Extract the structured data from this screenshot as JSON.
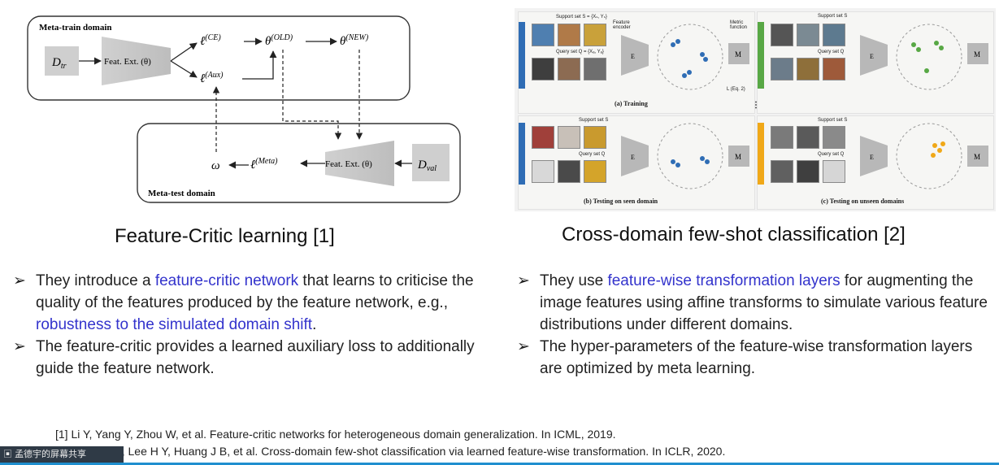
{
  "diagram": {
    "meta_train_label": "Meta-train domain",
    "meta_test_label": "Meta-test domain",
    "d_tr": "D",
    "d_tr_sub": "tr",
    "feat_ext": "Feat. Ext. (θ)",
    "l_ce": "ℓ",
    "l_ce_sup": "(CE)",
    "l_aux": "ℓ",
    "l_aux_sup": "(Aux)",
    "theta_old": "θ",
    "theta_old_sup": "(OLD)",
    "theta_new": "θ",
    "theta_new_sup": "(NEW)",
    "omega": "ω",
    "l_meta": "ℓ",
    "l_meta_sup": "(Meta)",
    "d_val": "D",
    "d_val_sub": "val"
  },
  "cdfs": {
    "support_set_top": "Support set S = {Xₛ, Yₛ}",
    "query_set_top": "Query set Q = {Xₐ, Yₐ}",
    "feature_encoder": "Feature encoder",
    "metric_function": "Metric function",
    "loss_label": "L (Eq. 2)",
    "training_caption": "(a) Training",
    "support_set": "Support set S",
    "query_set": "Query set Q",
    "seen_caption": "(b) Testing on seen domain",
    "unseen_caption": "(c) Testing on unseen domains",
    "f_label": "E",
    "m_label": "M"
  },
  "left": {
    "title": "Feature-Critic learning [1]",
    "bullets": [
      [
        {
          "t": "They introduce a ",
          "hl": false
        },
        {
          "t": "feature-critic network",
          "hl": true
        },
        {
          "t": " that learns to criticise the quality of the features produced by the feature network, e.g., ",
          "hl": false
        },
        {
          "t": "robustness to the simulated domain shift",
          "hl": true
        },
        {
          "t": ".",
          "hl": false
        }
      ],
      [
        {
          "t": " The feature-critic provides a learned auxiliary loss to additionally guide the feature network.",
          "hl": false
        }
      ]
    ]
  },
  "right": {
    "title": "Cross-domain few-shot classification [2]",
    "bullets": [
      [
        {
          "t": "They use ",
          "hl": false
        },
        {
          "t": "feature-wise transformation layers",
          "hl": true
        },
        {
          "t": " for augmenting the image features using affine transforms to simulate various feature distributions under different domains.",
          "hl": false
        }
      ],
      [
        {
          "t": " The hyper-parameters of the feature-wise transformation layers are optimized by meta learning.",
          "hl": false
        }
      ]
    ]
  },
  "references": [
    "[1] Li Y, Yang Y, Zhou W, et al. Feature-critic networks for heterogeneous domain generalization. In ICML, 2019.",
    "[2] Tseng H Y, Lee H Y, Huang J B, et al. Cross-domain few-shot classification via learned feature-wise transformation. In ICLR, 2020."
  ],
  "overlay_text": "孟德宇的屏幕共享",
  "colors": {
    "highlight": "#3333cc",
    "panel_blue": "#2f6db5",
    "panel_green": "#58a845",
    "panel_orange": "#f0a818",
    "bottom_bar": "#1f8fcf"
  }
}
